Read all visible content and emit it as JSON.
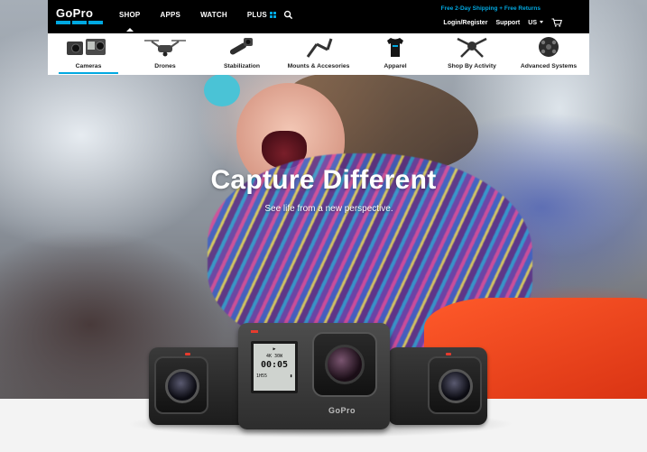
{
  "brand": {
    "logo_text": "GoPro"
  },
  "nav": {
    "items": [
      {
        "label": "SHOP",
        "active": true
      },
      {
        "label": "APPS"
      },
      {
        "label": "WATCH"
      }
    ],
    "plus_label": "PLUS"
  },
  "utility": {
    "promo": "Free 2-Day Shipping + Free Returns",
    "login": "Login/Register",
    "support": "Support",
    "region": "US"
  },
  "categories": [
    {
      "label": "Cameras",
      "active": true
    },
    {
      "label": "Drones"
    },
    {
      "label": "Stabilization"
    },
    {
      "label": "Mounts & Accesories"
    },
    {
      "label": "Apparel"
    },
    {
      "label": "Shop By Activity"
    },
    {
      "label": "Advanced Systems"
    }
  ],
  "hero": {
    "headline": "Capture Different",
    "subhead": "See life from a new perspective."
  },
  "camera_screen": {
    "line1": "4K 30W",
    "time": "00:05",
    "mode": "1H55"
  },
  "camera_brand": "GoPro",
  "colors": {
    "accent": "#00a8e1",
    "nav_bg": "#000000"
  },
  "icons": [
    "search-icon",
    "cart-icon",
    "chevron-down-icon"
  ]
}
